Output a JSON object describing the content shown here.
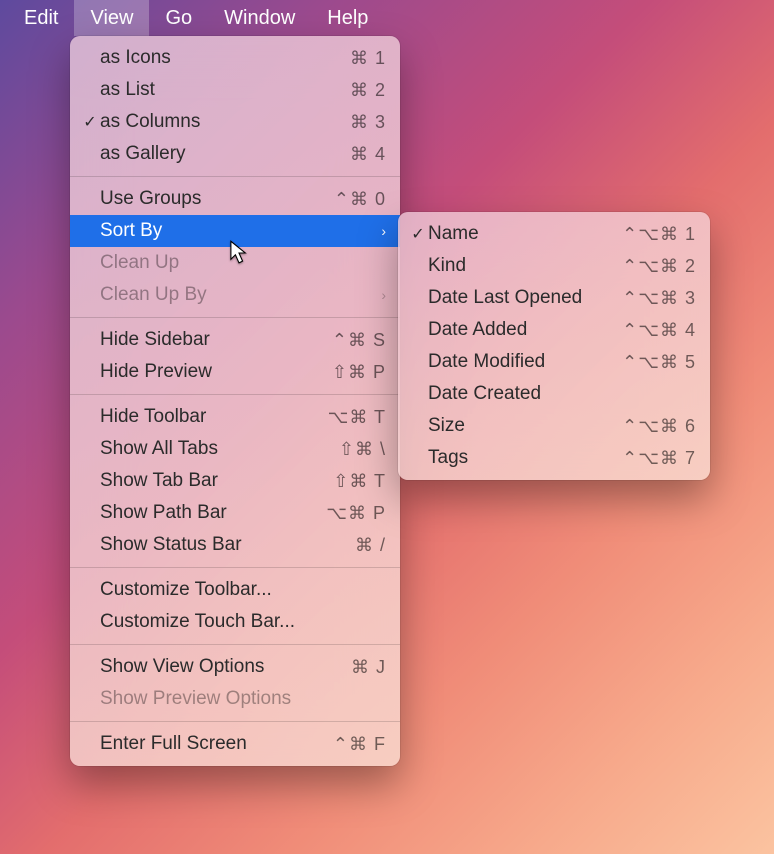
{
  "menubar": {
    "items": [
      {
        "id": "edit",
        "label": "Edit",
        "active": false
      },
      {
        "id": "view",
        "label": "View",
        "active": true
      },
      {
        "id": "go",
        "label": "Go",
        "active": false
      },
      {
        "id": "window",
        "label": "Window",
        "active": false
      },
      {
        "id": "help",
        "label": "Help",
        "active": false
      }
    ]
  },
  "viewMenu": {
    "groups": [
      [
        {
          "id": "as-icons",
          "label": "as Icons",
          "shortcut": "⌘ 1",
          "checked": false
        },
        {
          "id": "as-list",
          "label": "as List",
          "shortcut": "⌘ 2",
          "checked": false
        },
        {
          "id": "as-columns",
          "label": "as Columns",
          "shortcut": "⌘ 3",
          "checked": true
        },
        {
          "id": "as-gallery",
          "label": "as Gallery",
          "shortcut": "⌘ 4",
          "checked": false
        }
      ],
      [
        {
          "id": "use-groups",
          "label": "Use Groups",
          "shortcut": "⌃⌘ 0"
        },
        {
          "id": "sort-by",
          "label": "Sort By",
          "submenu": true,
          "highlighted": true
        },
        {
          "id": "clean-up",
          "label": "Clean Up",
          "disabled": true
        },
        {
          "id": "clean-up-by",
          "label": "Clean Up By",
          "submenu": true,
          "disabled": true
        }
      ],
      [
        {
          "id": "hide-sidebar",
          "label": "Hide Sidebar",
          "shortcut": "⌃⌘ S"
        },
        {
          "id": "hide-preview",
          "label": "Hide Preview",
          "shortcut": "⇧⌘ P"
        }
      ],
      [
        {
          "id": "hide-toolbar",
          "label": "Hide Toolbar",
          "shortcut": "⌥⌘ T"
        },
        {
          "id": "show-all-tabs",
          "label": "Show All Tabs",
          "shortcut": "⇧⌘ \\"
        },
        {
          "id": "show-tab-bar",
          "label": "Show Tab Bar",
          "shortcut": "⇧⌘ T"
        },
        {
          "id": "show-path-bar",
          "label": "Show Path Bar",
          "shortcut": "⌥⌘ P"
        },
        {
          "id": "show-status-bar",
          "label": "Show Status Bar",
          "shortcut": "⌘ /"
        }
      ],
      [
        {
          "id": "customize-toolbar",
          "label": "Customize Toolbar..."
        },
        {
          "id": "customize-touch-bar",
          "label": "Customize Touch Bar..."
        }
      ],
      [
        {
          "id": "show-view-options",
          "label": "Show View Options",
          "shortcut": "⌘ J"
        },
        {
          "id": "show-preview-options",
          "label": "Show Preview Options",
          "disabled": true
        }
      ],
      [
        {
          "id": "enter-full-screen",
          "label": "Enter Full Screen",
          "shortcut": "⌃⌘ F"
        }
      ]
    ]
  },
  "sortBySubmenu": {
    "items": [
      {
        "id": "sort-name",
        "label": "Name",
        "shortcut": "⌃⌥⌘ 1",
        "checked": true
      },
      {
        "id": "sort-kind",
        "label": "Kind",
        "shortcut": "⌃⌥⌘ 2"
      },
      {
        "id": "sort-date-last-opened",
        "label": "Date Last Opened",
        "shortcut": "⌃⌥⌘ 3"
      },
      {
        "id": "sort-date-added",
        "label": "Date Added",
        "shortcut": "⌃⌥⌘ 4"
      },
      {
        "id": "sort-date-modified",
        "label": "Date Modified",
        "shortcut": "⌃⌥⌘ 5"
      },
      {
        "id": "sort-date-created",
        "label": "Date Created"
      },
      {
        "id": "sort-size",
        "label": "Size",
        "shortcut": "⌃⌥⌘ 6"
      },
      {
        "id": "sort-tags",
        "label": "Tags",
        "shortcut": "⌃⌥⌘ 7"
      }
    ]
  }
}
